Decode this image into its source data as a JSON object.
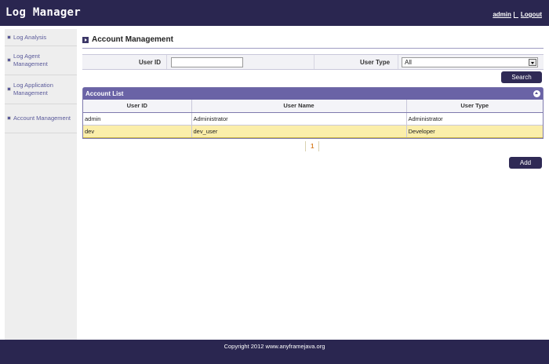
{
  "app": {
    "title": "Log Manager"
  },
  "user": {
    "name": "admin",
    "logout_label": "Logout"
  },
  "sidebar": {
    "items": [
      {
        "label": "Log Analysis"
      },
      {
        "label": "Log Agent Management"
      },
      {
        "label": "Log Application Management"
      },
      {
        "label": "Account Management"
      }
    ]
  },
  "main": {
    "title": "Account Management",
    "search": {
      "user_id_label": "User ID",
      "user_id_value": "",
      "user_type_label": "User Type",
      "user_type_selected": "All",
      "search_button": "Search"
    },
    "list": {
      "title": "Account List",
      "columns": [
        "User ID",
        "User Name",
        "User Type"
      ],
      "rows": [
        {
          "user_id": "admin",
          "user_name": "Administrator",
          "user_type": "Administrator",
          "selected": false
        },
        {
          "user_id": "dev",
          "user_name": "dev_user",
          "user_type": "Developer",
          "selected": true
        }
      ]
    },
    "pagination": {
      "current_page": "1"
    },
    "add_button": "Add"
  },
  "footer": {
    "text": "Copyright 2012 www.anyframejava.org"
  },
  "colors": {
    "header_bg": "#2a2650",
    "panel_head": "#6a63a6",
    "button": "#2f2a55",
    "selected_row": "#fbeeaa",
    "page_link": "#d9822b"
  }
}
